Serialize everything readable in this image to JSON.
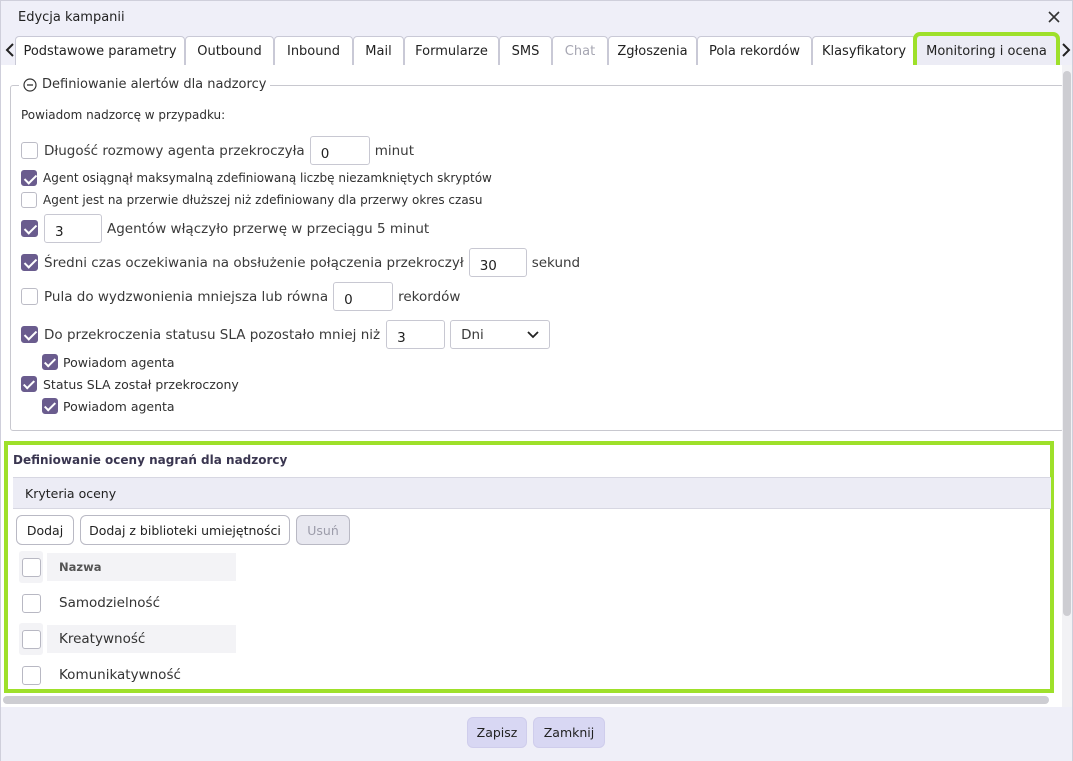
{
  "window": {
    "title": "Edycja kampanii"
  },
  "tabs": [
    {
      "label": "Podstawowe parametry"
    },
    {
      "label": "Outbound"
    },
    {
      "label": "Inbound"
    },
    {
      "label": "Mail"
    },
    {
      "label": "Formularze"
    },
    {
      "label": "SMS"
    },
    {
      "label": "Chat",
      "disabled": true
    },
    {
      "label": "Zgłoszenia"
    },
    {
      "label": "Pola rekordów"
    },
    {
      "label": "Klasyfikatory"
    },
    {
      "label": "Monitoring i ocena",
      "active": true
    }
  ],
  "alerts": {
    "legend": "Definiowanie alertów dla nadzorcy",
    "intro": "Powiadom nadzorcę w przypadku:",
    "call_length": {
      "label": "Długość rozmowy agenta przekroczyła",
      "value": "0",
      "unit": "minut",
      "checked": false
    },
    "max_scripts": {
      "label": "Agent osiągnął maksymalną zdefiniowaną liczbę niezamkniętych skryptów",
      "checked": true
    },
    "break_too_long": {
      "label": "Agent jest na przerwie dłuższej niż zdefiniowany dla przerwy okres czasu",
      "checked": false
    },
    "agents_on_break": {
      "value": "3",
      "label": "Agentów włączyło przerwę w przeciągu 5 minut",
      "checked": true
    },
    "avg_wait": {
      "label": "Średni czas oczekiwania na obsłużenie połączenia przekroczył",
      "value": "30",
      "unit": "sekund",
      "checked": true
    },
    "pool_low": {
      "label": "Pula do wydzwonienia mniejsza lub równa",
      "value": "0",
      "unit": "rekordów",
      "checked": false
    },
    "sla_remaining": {
      "label": "Do przekroczenia statusu SLA pozostało mniej niż",
      "value": "3",
      "unit_select": "Dni",
      "checked": true
    },
    "sla_remaining_notify": {
      "label": "Powiadom agenta",
      "checked": true
    },
    "sla_exceeded": {
      "label": "Status SLA został przekroczony",
      "checked": true
    },
    "sla_exceeded_notify": {
      "label": "Powiadom agenta",
      "checked": true
    }
  },
  "rating": {
    "title": "Definiowanie oceny nagrań dla nadzorcy",
    "criteria_header": "Kryteria oceny",
    "buttons": {
      "add": "Dodaj",
      "add_from_library": "Dodaj z biblioteki umiejętności",
      "remove": "Usuń"
    },
    "grid_header": "Nazwa",
    "rows": [
      {
        "name": "Samodzielność"
      },
      {
        "name": "Kreatywność"
      },
      {
        "name": "Komunikatywność"
      }
    ]
  },
  "footer": {
    "save": "Zapisz",
    "close": "Zamknij"
  },
  "colors": {
    "highlight": "#9ee02a",
    "checkbox": "#6a5c8e",
    "footer_button": "#d8d7f3"
  }
}
